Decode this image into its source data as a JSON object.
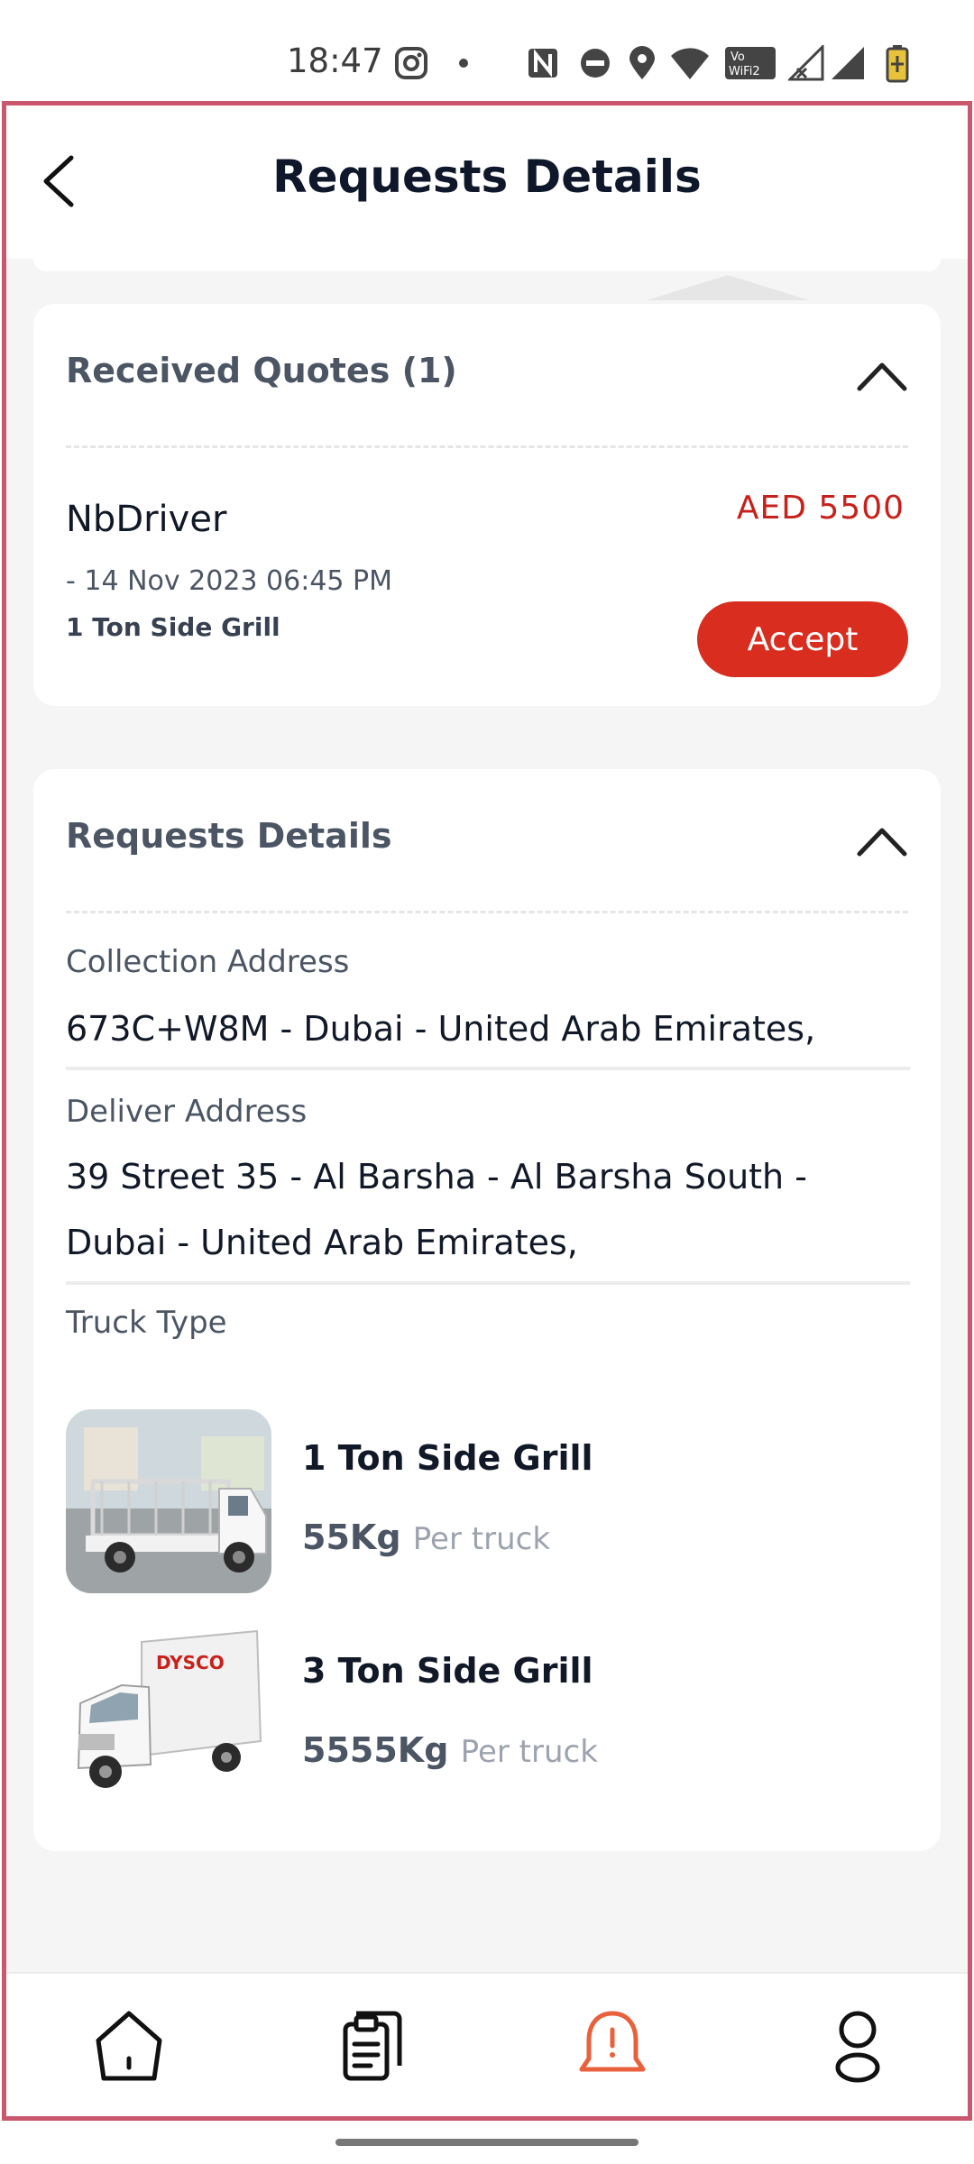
{
  "status_bar": {
    "time": "18:47",
    "icons": [
      "instagram-icon",
      "dot-icon",
      "nfc-icon",
      "do-not-disturb-icon",
      "location-icon",
      "wifi-icon",
      "vowifi-icon",
      "signal-icon",
      "signal-icon",
      "battery-icon"
    ]
  },
  "header": {
    "title": "Requests Details",
    "back_icon": "arrow-left-icon"
  },
  "quotes": {
    "title": "Received Quotes (1)",
    "items": [
      {
        "driver": "NbDriver",
        "price": "AED  5500",
        "date": "-  14 Nov 2023 06:45 PM",
        "truck": "1 Ton Side Grill",
        "accept_label": "Accept"
      }
    ]
  },
  "details": {
    "title": "Requests Details",
    "collection_label": "Collection Address",
    "collection_value": "673C+W8M - Dubai - United Arab Emirates,",
    "deliver_label": "Deliver Address",
    "deliver_value": "39 Street 35 - Al Barsha - Al Barsha South - Dubai - United Arab Emirates,",
    "truck_type_label": "Truck Type",
    "trucks": [
      {
        "name": "1 Ton Side Grill",
        "capacity": "55Kg",
        "per": "Per truck"
      },
      {
        "name": "3 Ton Side Grill",
        "capacity": "5555Kg",
        "per": "Per truck"
      }
    ]
  },
  "bottom_nav": {
    "items": [
      "home-icon",
      "orders-icon",
      "notifications-icon",
      "profile-icon"
    ],
    "active_index": 2,
    "active_color": "#e8603c",
    "inactive_color": "#111111"
  },
  "colors": {
    "accent_red": "#d92e1f",
    "price_red": "#c8211b",
    "frame_border": "#c9586f"
  }
}
